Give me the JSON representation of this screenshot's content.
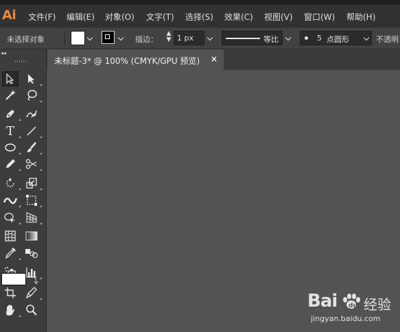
{
  "app": {
    "logo": "Ai"
  },
  "menu": [
    "文件(F)",
    "编辑(E)",
    "对象(O)",
    "文字(T)",
    "选择(S)",
    "效果(C)",
    "视图(V)",
    "窗口(W)",
    "帮助(H)"
  ],
  "control": {
    "selection_status": "未选择对象",
    "stroke_label": "描边：",
    "stroke_weight": "1 px",
    "stroke_profile": "等比",
    "brush_size": "5",
    "brush_shape": "点圆形",
    "opacity_label": "不透明"
  },
  "document": {
    "tab_title": "未标题-3* @ 100% (CMYK/GPU 预览)",
    "close_glyph": "×"
  },
  "tools": {
    "type_glyph": "T"
  },
  "watermark": {
    "brand": "Bai",
    "brand_cn": "经验",
    "url": "jingyan.baidu.com"
  },
  "colors": {
    "accent": "#e8893f",
    "menubar": "#323232",
    "controlbar": "#424242",
    "canvas": "#535353"
  }
}
